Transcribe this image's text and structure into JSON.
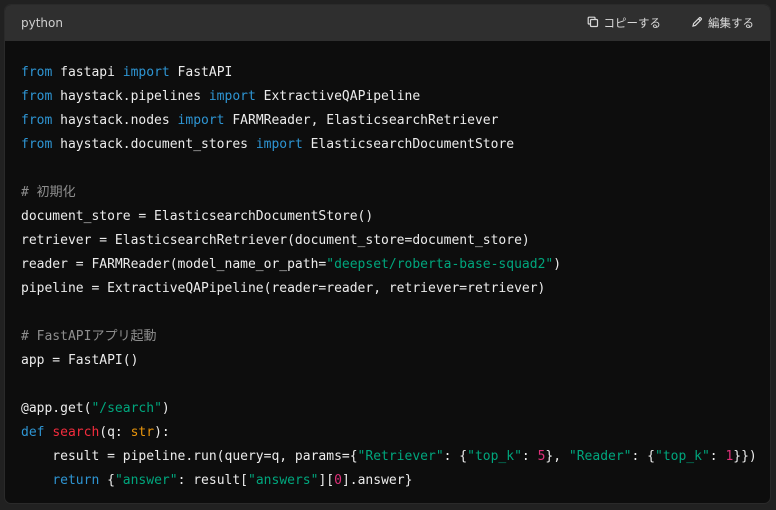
{
  "header": {
    "language": "python",
    "copy_label": "コピーする",
    "edit_label": "編集する"
  },
  "code": {
    "lines": [
      [
        {
          "t": "from",
          "c": "kw"
        },
        {
          "t": " fastapi "
        },
        {
          "t": "import",
          "c": "kw"
        },
        {
          "t": " FastAPI"
        }
      ],
      [
        {
          "t": "from",
          "c": "kw"
        },
        {
          "t": " haystack.pipelines "
        },
        {
          "t": "import",
          "c": "kw"
        },
        {
          "t": " ExtractiveQAPipeline"
        }
      ],
      [
        {
          "t": "from",
          "c": "kw"
        },
        {
          "t": " haystack.nodes "
        },
        {
          "t": "import",
          "c": "kw"
        },
        {
          "t": " FARMReader, ElasticsearchRetriever"
        }
      ],
      [
        {
          "t": "from",
          "c": "kw"
        },
        {
          "t": " haystack.document_stores "
        },
        {
          "t": "import",
          "c": "kw"
        },
        {
          "t": " ElasticsearchDocumentStore"
        }
      ],
      [],
      [
        {
          "t": "# 初期化",
          "c": "cm"
        }
      ],
      [
        {
          "t": "document_store = ElasticsearchDocumentStore()"
        }
      ],
      [
        {
          "t": "retriever = ElasticsearchRetriever(document_store=document_store)"
        }
      ],
      [
        {
          "t": "reader = FARMReader(model_name_or_path="
        },
        {
          "t": "\"deepset/roberta-base-squad2\"",
          "c": "str"
        },
        {
          "t": ")"
        }
      ],
      [
        {
          "t": "pipeline = ExtractiveQAPipeline(reader=reader, retriever=retriever)"
        }
      ],
      [],
      [
        {
          "t": "# FastAPIアプリ起動",
          "c": "cm"
        }
      ],
      [
        {
          "t": "app = FastAPI()"
        }
      ],
      [],
      [
        {
          "t": "@app.get(",
          "c": "dec"
        },
        {
          "t": "\"/search\"",
          "c": "str"
        },
        {
          "t": ")"
        }
      ],
      [
        {
          "t": "def",
          "c": "kw"
        },
        {
          "t": " "
        },
        {
          "t": "search",
          "c": "fn"
        },
        {
          "t": "(q: "
        },
        {
          "t": "str",
          "c": "bi"
        },
        {
          "t": "):"
        }
      ],
      [
        {
          "t": "    result = pipeline.run(query=q, params={"
        },
        {
          "t": "\"Retriever\"",
          "c": "str"
        },
        {
          "t": ": {"
        },
        {
          "t": "\"top_k\"",
          "c": "str"
        },
        {
          "t": ": "
        },
        {
          "t": "5",
          "c": "num"
        },
        {
          "t": "}, "
        },
        {
          "t": "\"Reader\"",
          "c": "str"
        },
        {
          "t": ": {"
        },
        {
          "t": "\"top_k\"",
          "c": "str"
        },
        {
          "t": ": "
        },
        {
          "t": "1",
          "c": "num"
        },
        {
          "t": "}})"
        }
      ],
      [
        {
          "t": "    "
        },
        {
          "t": "return",
          "c": "kw"
        },
        {
          "t": " {"
        },
        {
          "t": "\"answer\"",
          "c": "str"
        },
        {
          "t": ": result["
        },
        {
          "t": "\"answers\"",
          "c": "str"
        },
        {
          "t": "]["
        },
        {
          "t": "0",
          "c": "num"
        },
        {
          "t": "].answer}"
        }
      ]
    ]
  }
}
